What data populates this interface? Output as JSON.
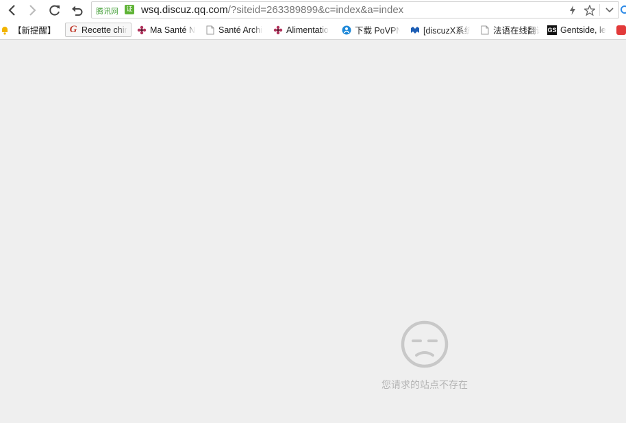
{
  "toolbar": {
    "back_icon": "chevron-left-icon",
    "forward_icon": "chevron-right-icon",
    "reload_icon": "reload-icon",
    "undo_icon": "undo-icon",
    "secure_label": "腾讯网",
    "secure_badge": "证",
    "url_host": "wsq.discuz.qq.com",
    "url_path": "/?siteid=263389899&c=index&a=index",
    "lightning_icon": "lightning-icon",
    "star_icon": "star-icon",
    "dropdown_icon": "chevron-down-icon"
  },
  "bookmarks": [
    {
      "label": "【新提醒】",
      "icon": "bell-icon"
    },
    {
      "label": "Recette chir",
      "icon": "g-logo-icon"
    },
    {
      "label": "Ma Santé N",
      "icon": "flower-icon"
    },
    {
      "label": "Santé Archi",
      "icon": "page-icon"
    },
    {
      "label": "Alimentatio",
      "icon": "flower-icon"
    },
    {
      "label": "下载 PoVPN",
      "icon": "povpn-icon"
    },
    {
      "label": "[discuzX系统",
      "icon": "discuz-icon"
    },
    {
      "label": "法语在线翻译",
      "icon": "page-icon"
    },
    {
      "label": "Gentside, le",
      "icon": "gs-logo-icon"
    },
    {
      "label": "",
      "icon": "red-badge-icon"
    }
  ],
  "content": {
    "icon": "sad-face-icon",
    "message": "您请求的站点不存在"
  },
  "colors": {
    "secure_green": "#5fb336",
    "face_gray": "#c8c8c8",
    "message_gray": "#b4b4b4",
    "background": "#efefef"
  }
}
